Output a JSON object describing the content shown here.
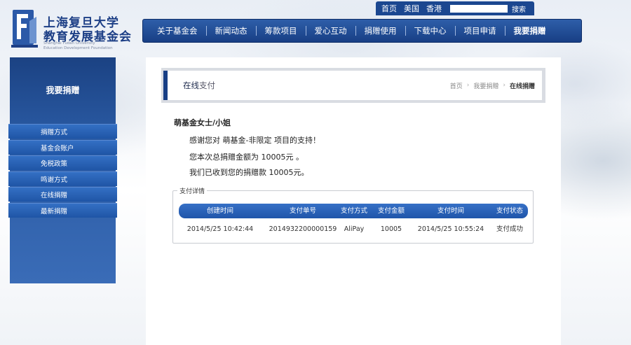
{
  "brand": {
    "name_line1": "上海复旦大学",
    "name_line2": "教育发展基金会",
    "en_line1": "Shanghai Fudan University",
    "en_line2": "Education Development Foundation",
    "accent_color": "#1b4790"
  },
  "topbar": {
    "links": [
      "首页",
      "美国",
      "香港"
    ],
    "search_placeholder": "",
    "search_button": "搜索"
  },
  "nav": {
    "items": [
      "关于基金会",
      "新闻动态",
      "筹款项目",
      "爱心互动",
      "捐赠使用",
      "下载中心",
      "项目申请",
      "我要捐赠"
    ]
  },
  "sidebar": {
    "title": "我要捐赠",
    "items": [
      "捐赠方式",
      "基金会账户",
      "免税政策",
      "鸣谢方式",
      "在线捐赠",
      "最新捐赠"
    ]
  },
  "content": {
    "title_main": "在线",
    "title_sub": "支付",
    "breadcrumb": [
      "首页",
      "我要捐赠",
      "在线捐赠"
    ],
    "salutation": "萌基金女士/小姐",
    "messages": [
      "感谢您对 萌基金-非限定 项目的支持！",
      "您本次总捐赠金额为 10005元 。",
      "我们已收到您的捐赠款 10005元。"
    ],
    "details_legend": "支付详情",
    "table": {
      "headers": [
        "创建时间",
        "支付单号",
        "支付方式",
        "支付金额",
        "支付时间",
        "支付状态"
      ],
      "rows": [
        [
          "2014/5/25 10:42:44",
          "2014932200000159",
          "AliPay",
          "10005",
          "2014/5/25 10:55:24",
          "支付成功"
        ]
      ]
    }
  }
}
